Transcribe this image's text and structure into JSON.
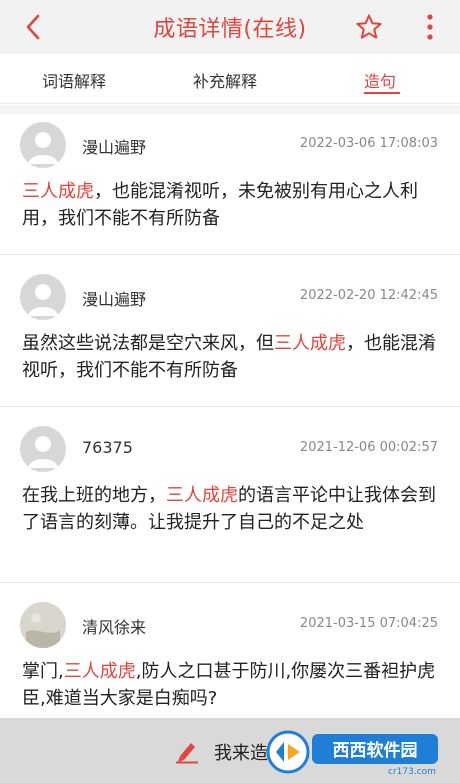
{
  "header": {
    "title": "成语详情(在线)",
    "back_icon": "chevron-left-icon",
    "star_icon": "star-outline-icon",
    "more_icon": "more-vertical-icon",
    "accent": "#e0463f"
  },
  "tabs": [
    {
      "label": "词语解释",
      "active": false
    },
    {
      "label": "补充解释",
      "active": false
    },
    {
      "label": "造句",
      "active": true
    }
  ],
  "entries": [
    {
      "username": "漫山遍野",
      "time": "2022-03-06 17:08:03",
      "before": "",
      "highlight": "三人成虎",
      "after": "，也能混淆视听，未免被别有用心之人利用，我们不能不有所防备"
    },
    {
      "username": "漫山遍野",
      "time": "2022-02-20 12:42:45",
      "before": "虽然这些说法都是空穴来风，但",
      "highlight": "三人成虎",
      "after": "，也能混淆视听，我们不能不有所防备"
    },
    {
      "username": "76375",
      "time": "2021-12-06 00:02:57",
      "before": "在我上班的地方，",
      "highlight": "三人成虎",
      "after": "的语言平论中让我体会到了语言的刻薄。让我提升了自己的不足之处"
    },
    {
      "username": "清风徐来",
      "time": "2021-03-15 07:04:25",
      "before": "掌门,",
      "highlight": "三人成虎",
      "after": ",防人之口甚于防川,你屡次三番袒护虎臣,难道当大家是白痴吗?"
    }
  ],
  "bottom_bar": {
    "label": "我来造句",
    "icon": "pen-icon"
  },
  "watermark": {
    "text": "西西软件园",
    "sub": "cr173.com"
  }
}
